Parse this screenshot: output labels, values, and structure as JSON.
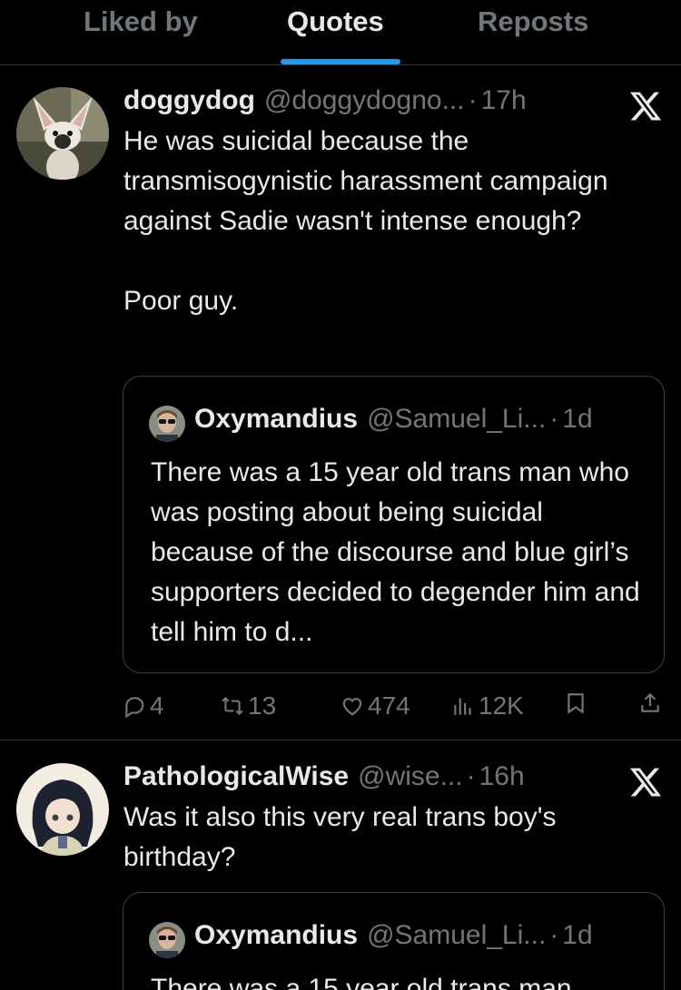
{
  "tabs": [
    {
      "label": "Liked by",
      "active": false
    },
    {
      "label": "Quotes",
      "active": true
    },
    {
      "label": "Reposts",
      "active": false
    }
  ],
  "accent_color": "#1d9bf0",
  "posts": [
    {
      "display_name": "doggydog",
      "handle": "@doggydogno...",
      "time": "17h",
      "text": "He was suicidal because the transmisogynistic harassment campaign against Sadie wasn't intense enough?\n\nPoor guy.",
      "quote": {
        "display_name": "Oxymandius",
        "handle": "@Samuel_Li...",
        "time": "1d",
        "text": "There was a 15 year old trans man who was posting about being suicidal because of the discourse and blue girl’s supporters decided to degender him and tell him to d..."
      },
      "actions": {
        "replies": "4",
        "reposts": "13",
        "likes": "474",
        "views": "12K"
      }
    },
    {
      "display_name": "PathologicalWise",
      "handle": "@wise...",
      "time": "16h",
      "text": "Was it also this very real trans boy's birthday?",
      "quote": {
        "display_name": "Oxymandius",
        "handle": "@Samuel_Li...",
        "time": "1d",
        "text": "There was a 15 year old trans man"
      }
    }
  ],
  "separator": "·",
  "icons": [
    "x-logo-icon",
    "reply-icon",
    "repost-icon",
    "like-icon",
    "views-icon",
    "bookmark-icon",
    "share-icon"
  ]
}
